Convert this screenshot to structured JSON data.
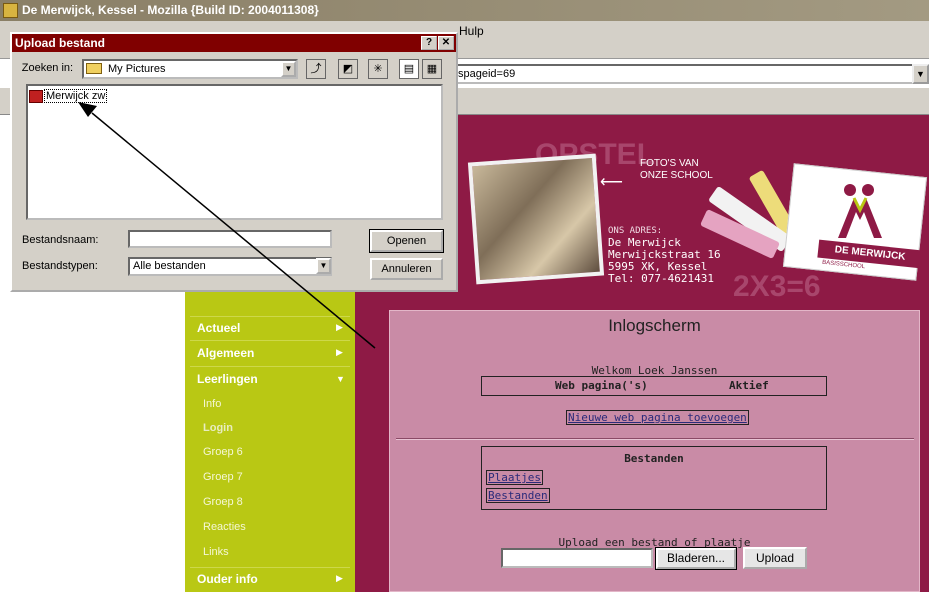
{
  "browser": {
    "title": "De Merwijck, Kessel - Mozilla {Build ID: 2004011308}",
    "menu_hulp": "Hulp",
    "url_fragment": "spageid=69"
  },
  "site": {
    "watermark_top": "OPSTEL",
    "watermark_bottom": "2X3=6",
    "photo_caption": "FOTO'S VAN ONZE SCHOOL",
    "address_label": "ONS ADRES:",
    "address_lines": [
      "De Merwijck",
      "Merwijckstraat 16",
      "5995 XK, Kessel",
      "Tel: 077-4621431"
    ],
    "logo_text": "DE MERWIJCK",
    "logo_subtext": "BASISSCHOOL"
  },
  "nav": {
    "items": [
      {
        "label": "Actueel"
      },
      {
        "label": "Algemeen"
      },
      {
        "label": "Leerlingen"
      }
    ],
    "sub_items": [
      "Info",
      "Login",
      "Groep 6",
      "Groep 7",
      "Groep 8",
      "Reacties",
      "Links"
    ],
    "last_item": "Ouder info"
  },
  "panel": {
    "title": "Inlogscherm",
    "welcome": "Welkom Loek Janssen",
    "col_web": "Web pagina('s)",
    "col_active": "Aktief",
    "new_page_link": "Nieuwe web pagina toevoegen",
    "files_title": "Bestanden",
    "link_images": "Plaatjes",
    "link_files": "Bestanden",
    "upload_label": "Upload een bestand of plaatje",
    "browse_button": "Bladeren...",
    "upload_button": "Upload"
  },
  "dialog": {
    "title": "Upload bestand",
    "help_button": "?",
    "close_button": "✕",
    "look_in_label": "Zoeken in:",
    "look_in_value": "My Pictures",
    "file_item": "Merwijck zw",
    "filename_label": "Bestandsnaam:",
    "filename_value": "",
    "filetype_label": "Bestandstypen:",
    "filetype_value": "Alle bestanden",
    "open_button": "Openen",
    "cancel_button": "Annuleren"
  },
  "colors": {
    "site_maroon": "#8e1a45",
    "sidebar_green": "#b9c814",
    "panel_pink": "#c98ba6",
    "dialog_title": "#800000"
  }
}
